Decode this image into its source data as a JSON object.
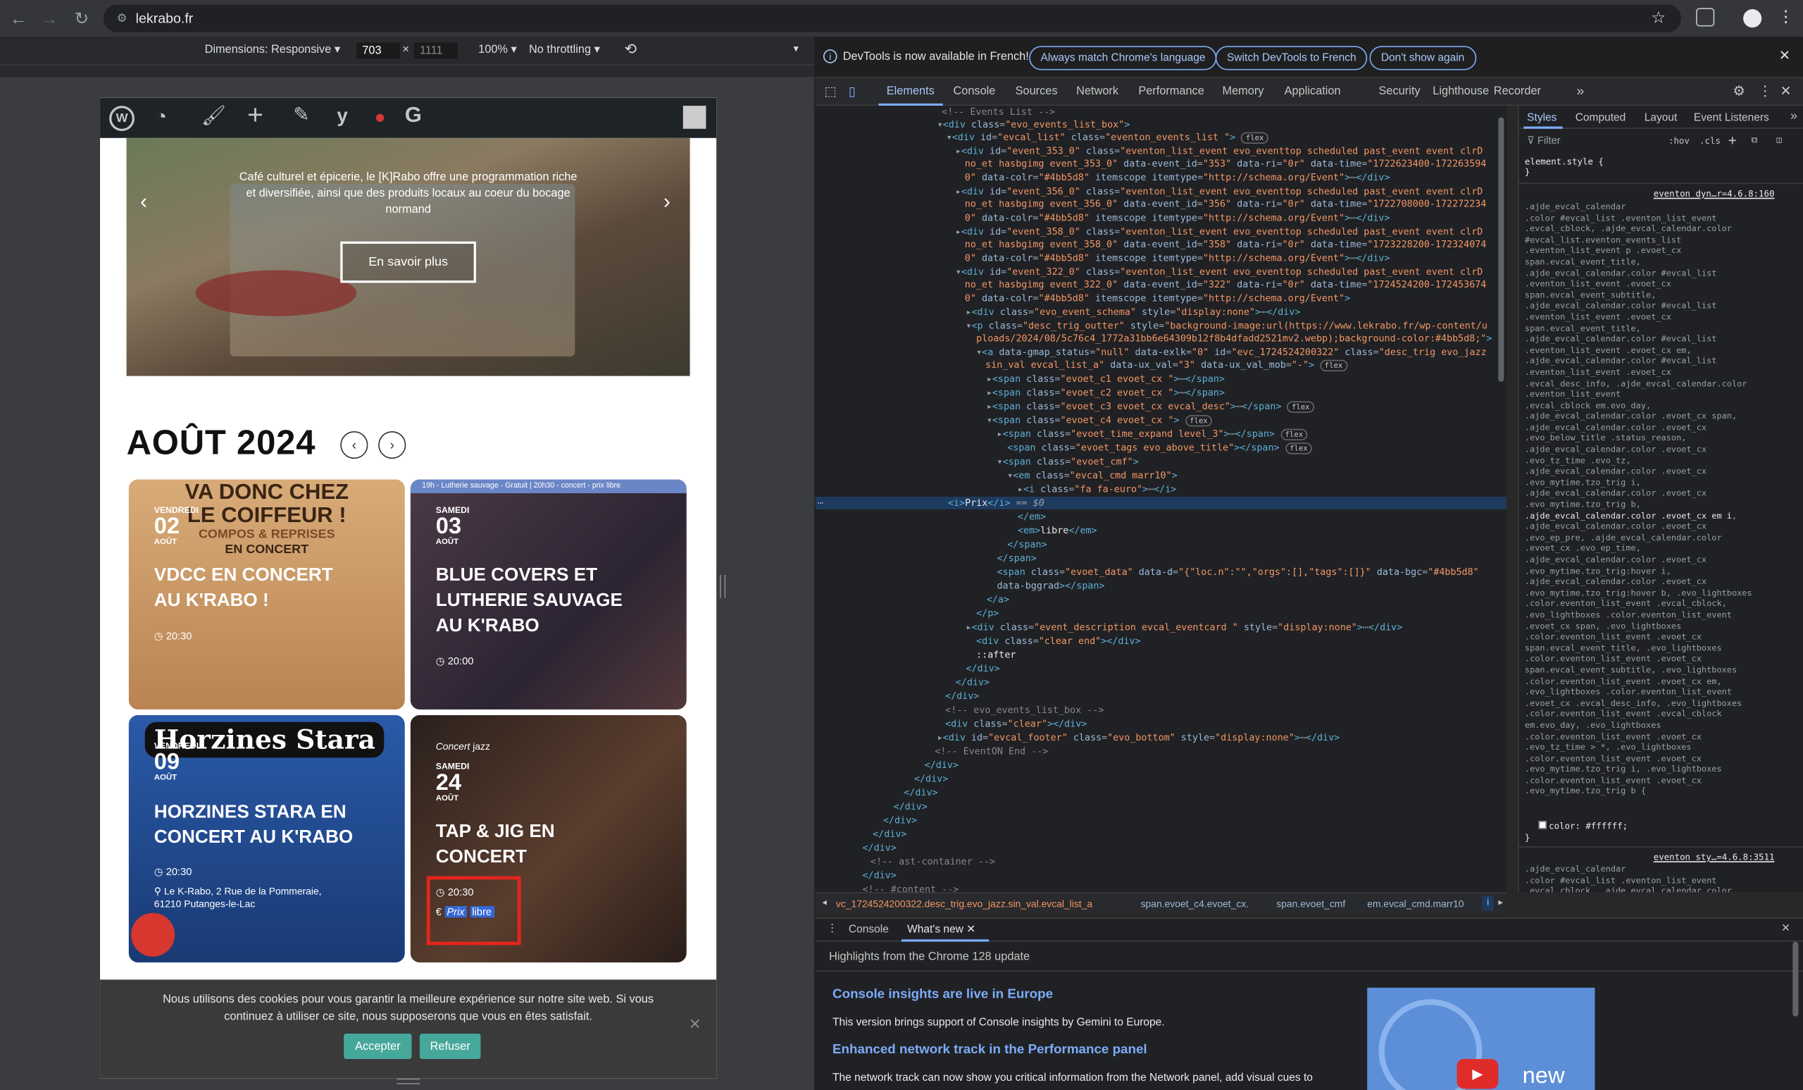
{
  "browser": {
    "url": "lekrabo.fr",
    "device_toolbar": {
      "dimensions_label": "Dimensions: Responsive",
      "width": "703",
      "times": "×",
      "height": "1111",
      "zoom": "100%",
      "throttling": "No throttling"
    }
  },
  "site": {
    "hero": {
      "text": "Café culturel et épicerie, le [K]Rabo offre une programmation riche et diversifiée, ainsi que des produits locaux au coeur du bocage normand",
      "button": "En savoir plus"
    },
    "month_heading": "AOÛT 2024",
    "events": [
      {
        "weekday": "VENDREDI",
        "day": "02",
        "month": "AOÛT",
        "title_line1": "VDCC EN CONCERT",
        "title_line2": "AU K'RABO !",
        "time": "20:30",
        "poster_top": "VA DONC CHEZ",
        "poster_mid": "LE COIFFEUR !",
        "poster_sub": "COMPOS & REPRISES",
        "poster_sub2": "EN CONCERT"
      },
      {
        "weekday": "SAMEDI",
        "day": "03",
        "month": "AOÛT",
        "title_line1": "BLUE COVERS ET",
        "title_line2": "LUTHERIE SAUVAGE",
        "title_line3": "AU K'RABO",
        "time": "20:00",
        "poster_top": "19h - Lutherie sauvage - Gratuit | 20h30 - concert - prix libre"
      },
      {
        "weekday": "VENDREDI",
        "day": "09",
        "month": "AOÛT",
        "title_line1": "HORZINES STARA EN",
        "title_line2": "CONCERT AU K'RABO",
        "time": "20:30",
        "location_line1": "Le K-Rabo, 2 Rue de la Pommeraie,",
        "location_line2": "61210 Putanges-le-Lac",
        "poster_top": "Horzines Stara"
      },
      {
        "weekday": "SAMEDI",
        "day": "24",
        "month": "AOÛT",
        "title_line1": "TAP & JIG EN",
        "title_line2": "CONCERT",
        "time": "20:30",
        "tag1": "Concert",
        "tag2": "jazz",
        "price_prefix": "Prix",
        "price_suffix": "libre",
        "euro": "€"
      }
    ],
    "cookie": {
      "text": "Nous utilisons des cookies pour vous garantir la meilleure expérience sur notre site web. Si vous continuez à utiliser ce site, nous supposerons que vous en êtes satisfait.",
      "accept": "Accepter",
      "refuse": "Refuser"
    }
  },
  "devtools": {
    "banner": {
      "text": "DevTools is now available in French!",
      "btn1": "Always match Chrome's language",
      "btn2": "Switch DevTools to French",
      "btn3": "Don't show again"
    },
    "tabs": [
      "Elements",
      "Console",
      "Sources",
      "Network",
      "Performance",
      "Memory",
      "Application",
      "Security",
      "Lighthouse",
      "Recorder"
    ],
    "styles_tabs": [
      "Styles",
      "Computed",
      "Layout",
      "Event Listeners"
    ],
    "filter_placeholder": "Filter",
    "hov": ":hov",
    "cls": ".cls",
    "element_style": "element.style {",
    "rule1_source": "eventon_dyn…r=4.6.8:160",
    "rule2_source": "eventon_sty…=4.6.8:3511",
    "color_decl": "color: #ffffff;",
    "breadcrumbs": [
      "vc_1724524200322.desc_trig.evo_jazz.sin_val.evcal_list_a",
      "span.evoet_c4.evoet_cx.",
      "span.evoet_cmf",
      "em.evcal_cmd.marr10",
      "i"
    ],
    "drawer": {
      "tabs": [
        "Console",
        "What's new"
      ],
      "highlights": "Highlights from the Chrome 128 update",
      "h1": "Console insights are live in Europe",
      "p1": "This version brings support of Console insights by Gemini to Europe.",
      "h2": "Enhanced network track in the Performance panel",
      "p2": "The network track can now show you critical information from the Network panel, add visual cues to",
      "video_word": "new"
    }
  }
}
